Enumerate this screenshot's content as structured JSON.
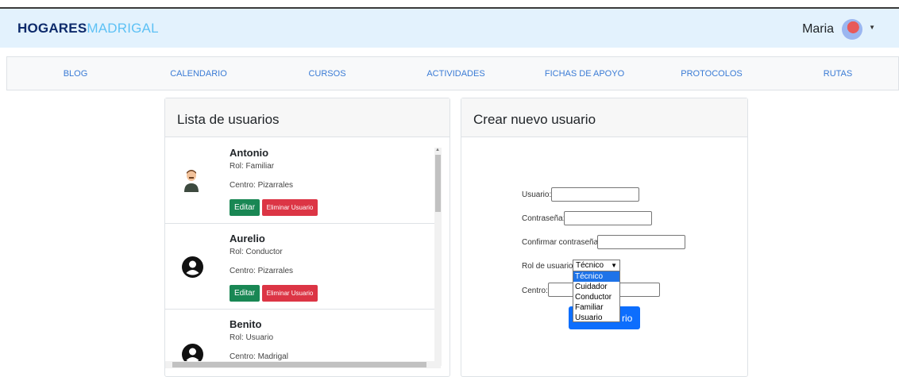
{
  "header": {
    "brand_bold": "HOGARES",
    "brand_light": "MADRIGAL",
    "user_name": "Maria",
    "avatar_icon": "user-avatar",
    "caret_icon": "caret-down-icon",
    "background": "#e3f2fd"
  },
  "nav": {
    "items": [
      "BLOG",
      "CALENDARIO",
      "CURSOS",
      "ACTIVIDADES",
      "FICHAS DE APOYO",
      "PROTOCOLOS",
      "RUTAS"
    ],
    "link_color": "#3a7bd5"
  },
  "users_panel": {
    "title": "Lista de usuarios",
    "edit_label": "Editar",
    "delete_label": "Eliminar Usuario",
    "users": [
      {
        "name": "Antonio",
        "role": "Rol: Familiar",
        "center": "Centro: Pizarrales",
        "icon": "cartoon-person-icon"
      },
      {
        "name": "Aurelio",
        "role": "Rol: Conductor",
        "center": "Centro: Pizarrales",
        "icon": "user-circle-icon"
      },
      {
        "name": "Benito",
        "role": "Rol: Usuario",
        "center": "Centro: Madrigal",
        "icon": "user-circle-icon"
      }
    ],
    "colors": {
      "edit": "#198754",
      "delete": "#dc3545"
    }
  },
  "create_panel": {
    "title": "Crear nuevo usuario",
    "usuario_label": "Usuario:",
    "password_label": "Contraseña:",
    "confirm_label": "Confirmar contraseña:",
    "role_label": "Rol de usuario:",
    "role_selected": "Técnico",
    "role_options": [
      "Técnico",
      "Cuidador",
      "Conductor",
      "Familiar",
      "Usuario"
    ],
    "center_label": "Centro:",
    "submit_visible_text": "rio",
    "submit_color": "#0d6efd"
  }
}
